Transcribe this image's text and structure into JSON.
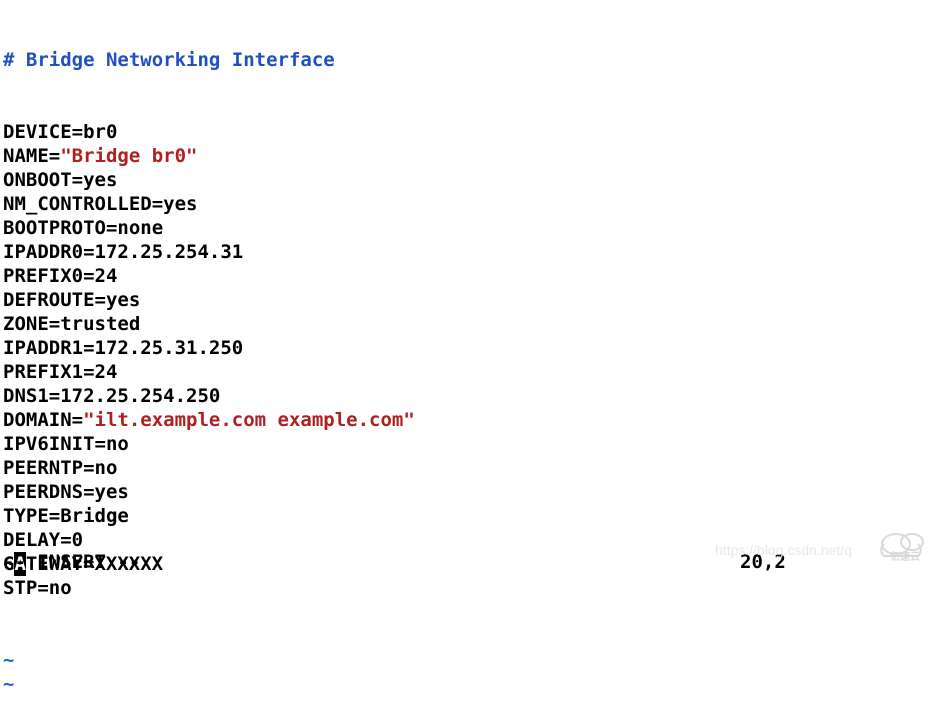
{
  "file": {
    "comment": "# Bridge Networking Interface",
    "lines": [
      {
        "key": "DEVICE",
        "eq": "=",
        "value": "br0"
      },
      {
        "key": "NAME",
        "eq": "=",
        "value": "\"Bridge br0\"",
        "string": true
      },
      {
        "key": "ONBOOT",
        "eq": "=",
        "value": "yes"
      },
      {
        "key": "NM_CONTROLLED",
        "eq": "=",
        "value": "yes"
      },
      {
        "key": "BOOTPROTO",
        "eq": "=",
        "value": "none"
      },
      {
        "key": "IPADDR0",
        "eq": "=",
        "value": "172.25.254.31"
      },
      {
        "key": "PREFIX0",
        "eq": "=",
        "value": "24"
      },
      {
        "key": "DEFROUTE",
        "eq": "=",
        "value": "yes"
      },
      {
        "key": "ZONE",
        "eq": "=",
        "value": "trusted"
      },
      {
        "key": "IPADDR1",
        "eq": "=",
        "value": "172.25.31.250"
      },
      {
        "key": "PREFIX1",
        "eq": "=",
        "value": "24"
      },
      {
        "key": "DNS1",
        "eq": "=",
        "value": "172.25.254.250"
      },
      {
        "key": "DOMAIN",
        "eq": "=",
        "value": "\"ilt.example.com example.com\"",
        "string": true
      },
      {
        "key": "IPV6INIT",
        "eq": "=",
        "value": "no"
      },
      {
        "key": "PEERNTP",
        "eq": "=",
        "value": "no"
      },
      {
        "key": "PEERDNS",
        "eq": "=",
        "value": "yes"
      },
      {
        "key": "TYPE",
        "eq": "=",
        "value": "Bridge"
      },
      {
        "key": "DELAY",
        "eq": "=",
        "value": "0"
      },
      {
        "key": "GATEWAY",
        "eq": "=",
        "value": "XXXXXX",
        "cursor_at": 1
      },
      {
        "key": "STP",
        "eq": "=",
        "value": "no"
      }
    ]
  },
  "tildes": [
    "~",
    "~"
  ],
  "status": {
    "mode": "-- INSERT --",
    "position": "20,2"
  },
  "watermark": {
    "text": "https://blog.csdn.net/q",
    "brand": "亿速云"
  }
}
